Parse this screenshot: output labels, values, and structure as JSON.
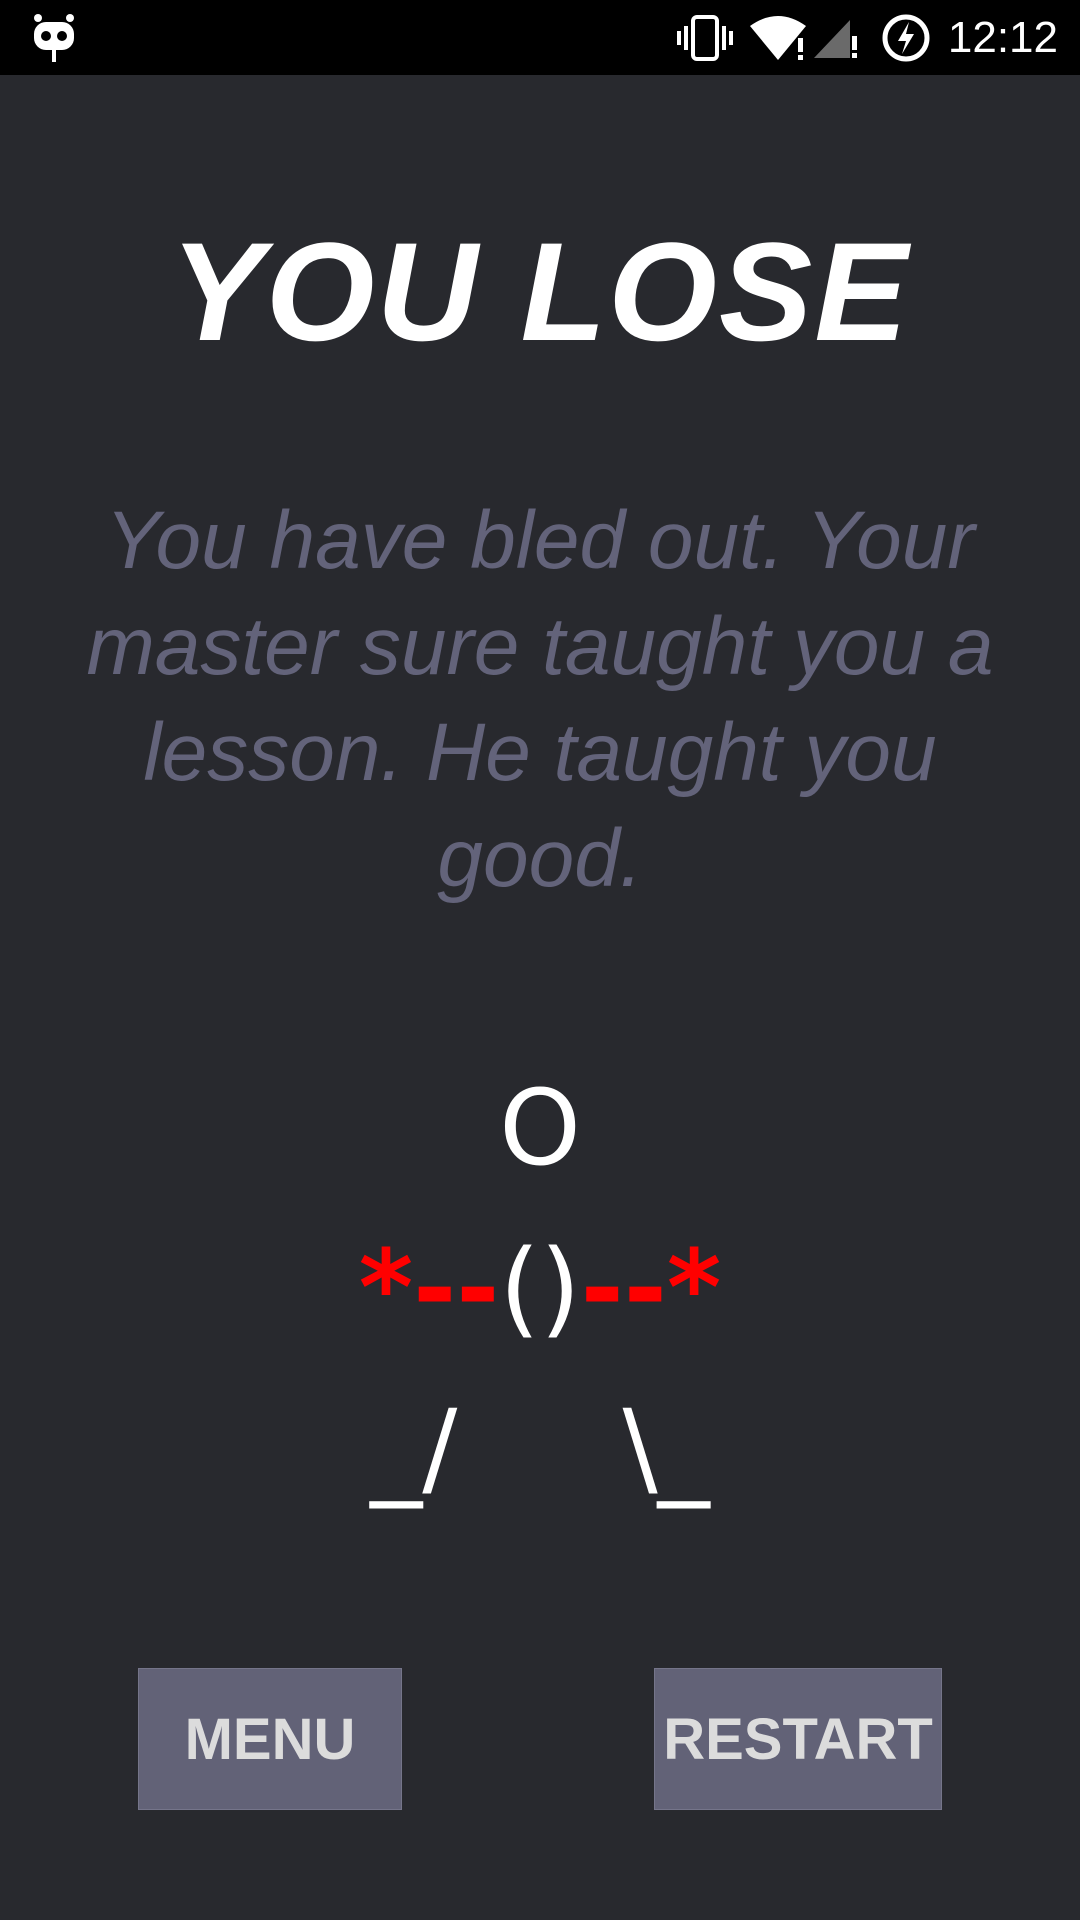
{
  "status_bar": {
    "time": "12:12",
    "icons": [
      "app-notification-icon",
      "vibrate-icon",
      "wifi-icon",
      "cell-signal-icon",
      "battery-charging-icon"
    ]
  },
  "game": {
    "title": "YOU LOSE",
    "message": "You have bled out. Your master sure taught you a lesson. He taught you good.",
    "figure": {
      "head": "O",
      "left_blood": "*--",
      "torso": "()",
      "right_blood": "--*",
      "left_leg": "_/",
      "right_leg": "\\_"
    },
    "colors": {
      "background": "#28292e",
      "title": "#ffffff",
      "message": "#63637a",
      "blood": "#ff0000",
      "button_bg": "#626277",
      "button_text": "#dcdcdc"
    }
  },
  "buttons": {
    "menu_label": "MENU",
    "restart_label": "RESTART"
  }
}
